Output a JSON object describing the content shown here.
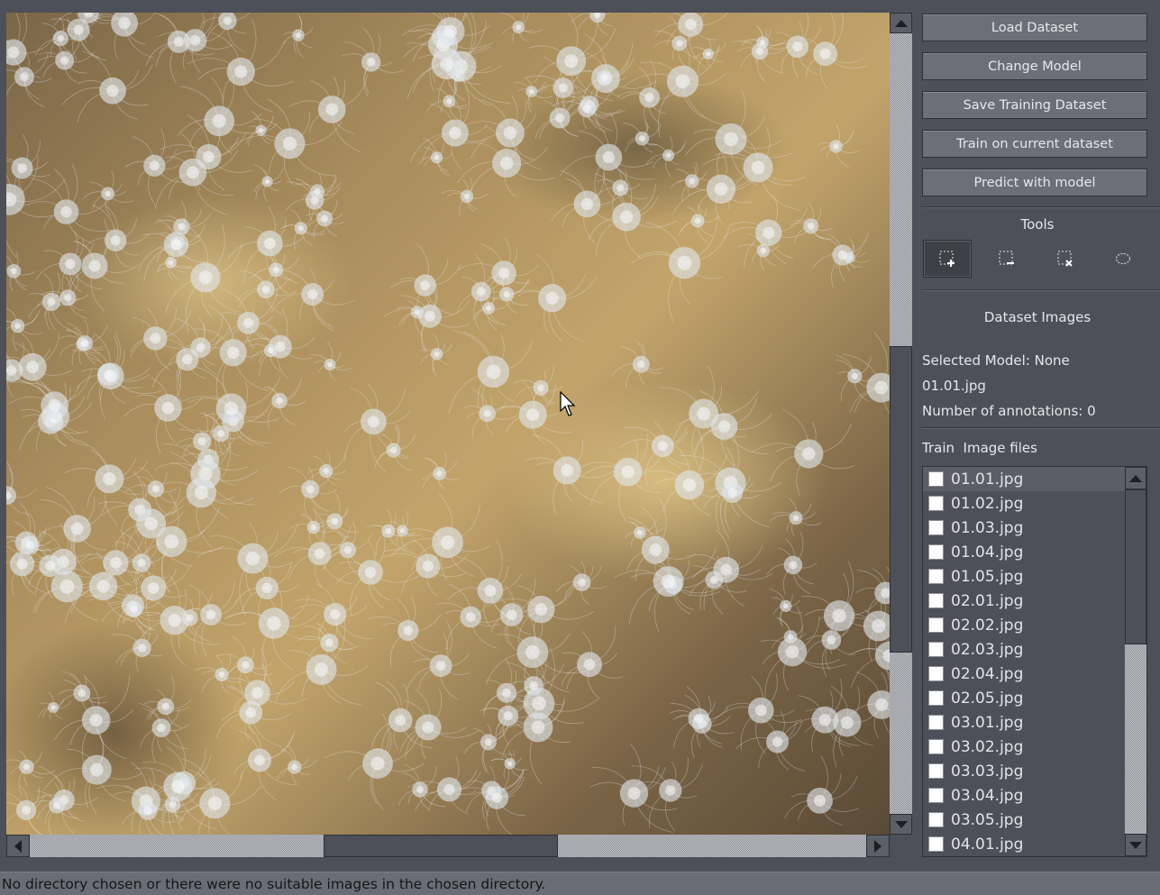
{
  "buttons": {
    "load_dataset": "Load Dataset",
    "change_model": "Change Model",
    "save_training_dataset": "Save Training Dataset",
    "train_current": "Train on current dataset",
    "predict": "Predict with model"
  },
  "tools": {
    "title": "Tools",
    "items": [
      {
        "name": "add-rectangle",
        "active": true
      },
      {
        "name": "subtract-rectangle",
        "active": false
      },
      {
        "name": "delete-rectangle",
        "active": false
      },
      {
        "name": "ellipse",
        "active": false
      }
    ]
  },
  "dataset": {
    "title": "Dataset Images",
    "selected_model": "Selected Model: None",
    "current_file": "01.01.jpg",
    "annotations": "Number of annotations: 0",
    "list_header": "Train  Image files",
    "files": [
      "01.01.jpg",
      "01.02.jpg",
      "01.03.jpg",
      "01.04.jpg",
      "01.05.jpg",
      "02.01.jpg",
      "02.02.jpg",
      "02.03.jpg",
      "02.04.jpg",
      "02.05.jpg",
      "03.01.jpg",
      "03.02.jpg",
      "03.03.jpg",
      "03.04.jpg",
      "03.05.jpg",
      "04.01.jpg"
    ],
    "selected_index": 0
  },
  "status": "No directory chosen or there were no suitable images in the chosen directory.",
  "colors": {
    "background": "#4d5059",
    "button": "#6c6f78",
    "status_bar": "#6a6d75"
  }
}
